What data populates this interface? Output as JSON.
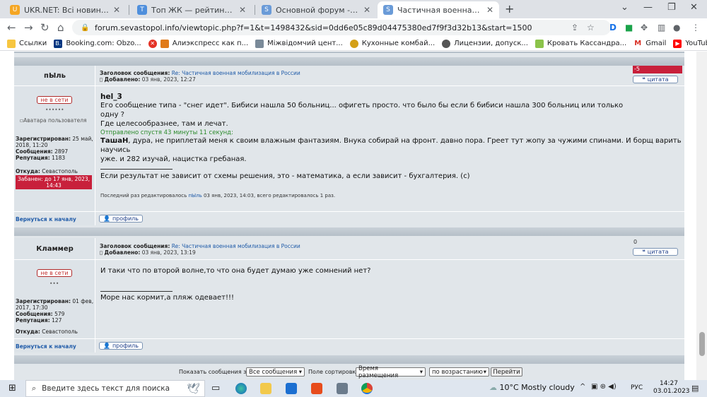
{
  "tabs": [
    {
      "title": "UKR.NET: Всі новини України, ос",
      "fav_color": "#f5a623",
      "fav_glyph": "U"
    },
    {
      "title": "Топ ЖК — рейтинг постов бло",
      "fav_color": "#4f8fdc",
      "fav_glyph": "Т"
    },
    {
      "title": "Основной форум - Sevastopol.in",
      "fav_color": "#6a9bd8",
      "fav_glyph": "S"
    },
    {
      "title": "Частичная военная мобилизаци",
      "fav_color": "#6a9bd8",
      "fav_glyph": "S"
    }
  ],
  "toolbar": {
    "url": "forum.sevastopol.info/viewtopic.php?f=1&t=1498432&sid=0dd6e05c89d04475380ed7f9f3d32b13&start=1500"
  },
  "bookmarks": [
    {
      "label": "Ссылки",
      "color": "#f7c640",
      "glyph": ""
    },
    {
      "label": "Booking.com: Obzo...",
      "color": "#003580",
      "glyph": "B."
    },
    {
      "label": "Алиэкспресс как п...",
      "color": "#e43225",
      "glyph": "A"
    },
    {
      "label": "Міжвідомчий цент...",
      "color": "#7a8a99",
      "glyph": ""
    },
    {
      "label": "Кухонные комбай...",
      "color": "#d4a017",
      "glyph": ""
    },
    {
      "label": "Лицензии, допуск...",
      "color": "#555555",
      "glyph": ""
    },
    {
      "label": "Кровать Кассандра...",
      "color": "#8bc34a",
      "glyph": ""
    },
    {
      "label": "Gmail",
      "color": "#d93025",
      "glyph": "M"
    },
    {
      "label": "YouTube",
      "color": "#ff0000",
      "glyph": "▶"
    }
  ],
  "post1": {
    "author": "пЫль",
    "subject_label": "Заголовок сообщения:",
    "subject": "Re: Частичная военная мобилизация в России",
    "added_label": "Добавлено:",
    "added": "03 янв, 2023, 12:27",
    "rating": "-5",
    "quote_label": "цитата",
    "status": "не в сети",
    "stars": "••••••",
    "avatar_alt": "Аватара пользователя",
    "reg_label": "Зарегистрирован:",
    "reg": "25 май, 2018, 11:20",
    "msgs_label": "Сообщения:",
    "msgs": "2897",
    "rep_label": "Репутация:",
    "rep": "1183",
    "from_label": "Откуда:",
    "from": "Севастополь",
    "banned": "Забанен: до 17 янв, 2023, 14:43",
    "quote_author": "hel_3",
    "quote_line1": "Его сообщение типа - \"снег идет\". Бибиси нашла 50 больниц... офигеть просто. что было бы если б бибиси нашла 300 больниц или только одну ?",
    "quote_line2": "Где целесообразнее, там и лечат.",
    "sent_after": "Отправлено спустя 43 минуты 11 секунд:",
    "reply_name": "ТашаН",
    "reply_line1": ", дура, не приплетай меня к своим влажным фантазиям. Внука собирай на фронт. давно пора. Греет тут жопу за чужими спинами. И борщ варить научись",
    "reply_line2": "уже. и 282 изучай, нацистка гребаная.",
    "signature": "Если результат не зависит от схемы решения, это - математика, а если зависит - бухгалтерия. (с)",
    "edited": "Последний раз редактировалось",
    "edited_by": "пЫль",
    "edited_rest": "03 янв, 2023, 14:03, всего редактировалось 1 раз.",
    "back": "Вернуться к началу",
    "profile": "профиль"
  },
  "post2": {
    "author": "Кламмер",
    "subject_label": "Заголовок сообщения:",
    "subject": "Re: Частичная военная мобилизация в России",
    "added_label": "Добавлено:",
    "added": "03 янв, 2023, 13:19",
    "rating": "0",
    "quote_label": "цитата",
    "status": "не в сети",
    "stars": "•••",
    "reg_label": "Зарегистрирован:",
    "reg": "01 фев, 2017, 17:30",
    "msgs_label": "Сообщения:",
    "msgs": "579",
    "rep_label": "Репутация:",
    "rep": "127",
    "from_label": "Откуда:",
    "from": "Севастополь",
    "text": "И таки что по второй волне,то что она будет думаю уже сомнений нет?",
    "signature": "Море нас кормит,а пляж одевает!!!",
    "back": "Вернуться к началу",
    "profile": "профиль"
  },
  "sortbar": {
    "show_label": "Показать сообщения за:",
    "show_value": "Все сообщения",
    "sort_label": "Поле сортировки",
    "sort_value": "Время размещения",
    "order_value": "по возрастанию",
    "go": "Перейти"
  },
  "taskbar": {
    "search_placeholder": "Введите здесь текст для поиска",
    "weather": "10°C  Mostly cloudy",
    "lang": "РУС",
    "time": "14:27",
    "date": "03.01.2023"
  }
}
